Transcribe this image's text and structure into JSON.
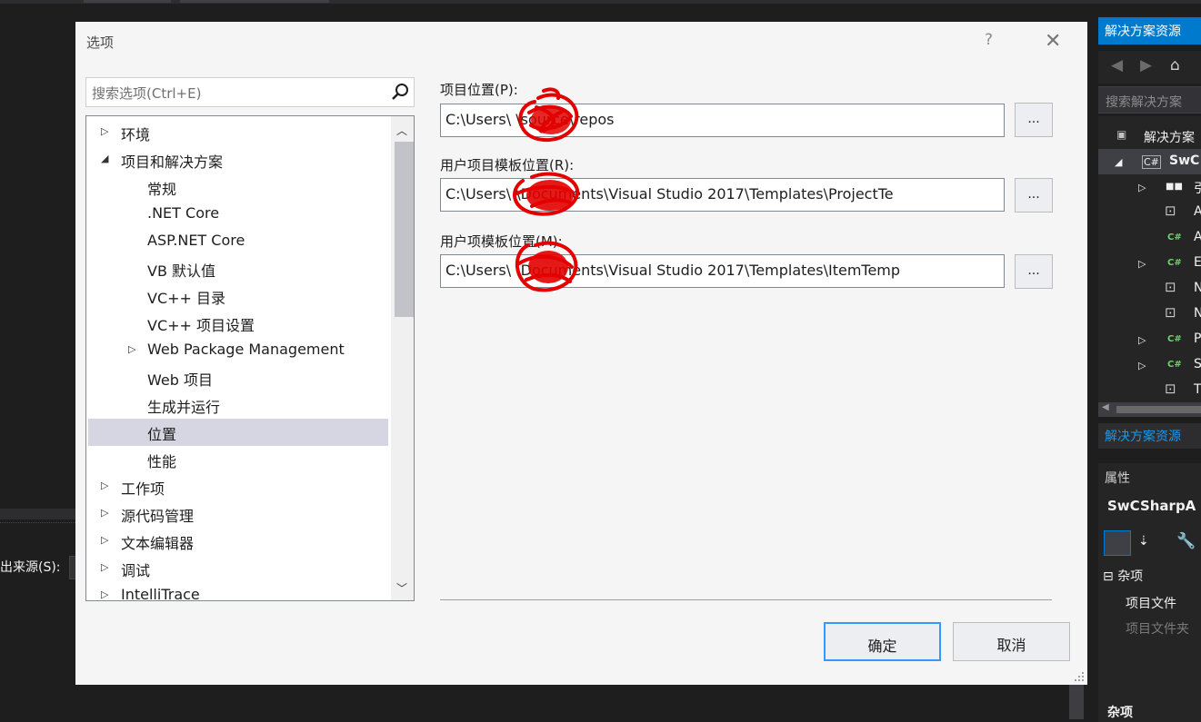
{
  "dialog": {
    "title": "选项",
    "help": "?",
    "close": "✕",
    "search_placeholder": "搜索选项(Ctrl+E)",
    "tree": [
      {
        "label": "环境",
        "arrow": "▷",
        "level": 0
      },
      {
        "label": "项目和解决方案",
        "arrow": "◢",
        "level": 0
      },
      {
        "label": "常规",
        "arrow": "",
        "level": 1
      },
      {
        "label": ".NET Core",
        "arrow": "",
        "level": 1
      },
      {
        "label": "ASP.NET Core",
        "arrow": "",
        "level": 1
      },
      {
        "label": "VB 默认值",
        "arrow": "",
        "level": 1
      },
      {
        "label": "VC++ 目录",
        "arrow": "",
        "level": 1
      },
      {
        "label": "VC++ 项目设置",
        "arrow": "",
        "level": 1
      },
      {
        "label": "Web Package Management",
        "arrow": "▷",
        "level": 1
      },
      {
        "label": "Web 项目",
        "arrow": "",
        "level": 1
      },
      {
        "label": "生成并运行",
        "arrow": "",
        "level": 1
      },
      {
        "label": "位置",
        "arrow": "",
        "level": 1,
        "selected": true
      },
      {
        "label": "性能",
        "arrow": "",
        "level": 1
      },
      {
        "label": "工作项",
        "arrow": "▷",
        "level": 0
      },
      {
        "label": "源代码管理",
        "arrow": "▷",
        "level": 0
      },
      {
        "label": "文本编辑器",
        "arrow": "▷",
        "level": 0
      },
      {
        "label": "调试",
        "arrow": "▷",
        "level": 0
      },
      {
        "label": "IntelliTrace",
        "arrow": "▷",
        "level": 0
      }
    ],
    "fields": [
      {
        "label": "项目位置(P):",
        "value": "C:\\Users\\        \\source\\repos",
        "browse": "..."
      },
      {
        "label": "用户项目模板位置(R):",
        "value": "C:\\Users\\        \\Documents\\Visual Studio 2017\\Templates\\ProjectTe",
        "browse": "..."
      },
      {
        "label": "用户项模板位置(M):",
        "value": "C:\\Users\\        \\Documents\\Visual Studio 2017\\Templates\\ItemTemp",
        "browse": "..."
      }
    ],
    "ok": "确定",
    "cancel": "取消"
  },
  "background": {
    "left_label": "出来源(S):",
    "solution_explorer": {
      "title": "解决方案资源",
      "search": "搜索解决方案",
      "solution_item": "解决方案",
      "project_item": "SwC",
      "rows": [
        "引",
        "A",
        "A",
        "E",
        "N",
        "N",
        "P",
        "S",
        "T"
      ],
      "tab": "解决方案资源"
    },
    "properties": {
      "title": "属性",
      "object": "SwCSharpA",
      "category": "杂项",
      "row1": "项目文件",
      "row2": "项目文件夹",
      "footer": "杂项"
    }
  },
  "colors": {
    "accent": "#007acc",
    "selection": "#d5d6e1",
    "ok_border": "#3399ff",
    "redaction": "#e30000"
  }
}
